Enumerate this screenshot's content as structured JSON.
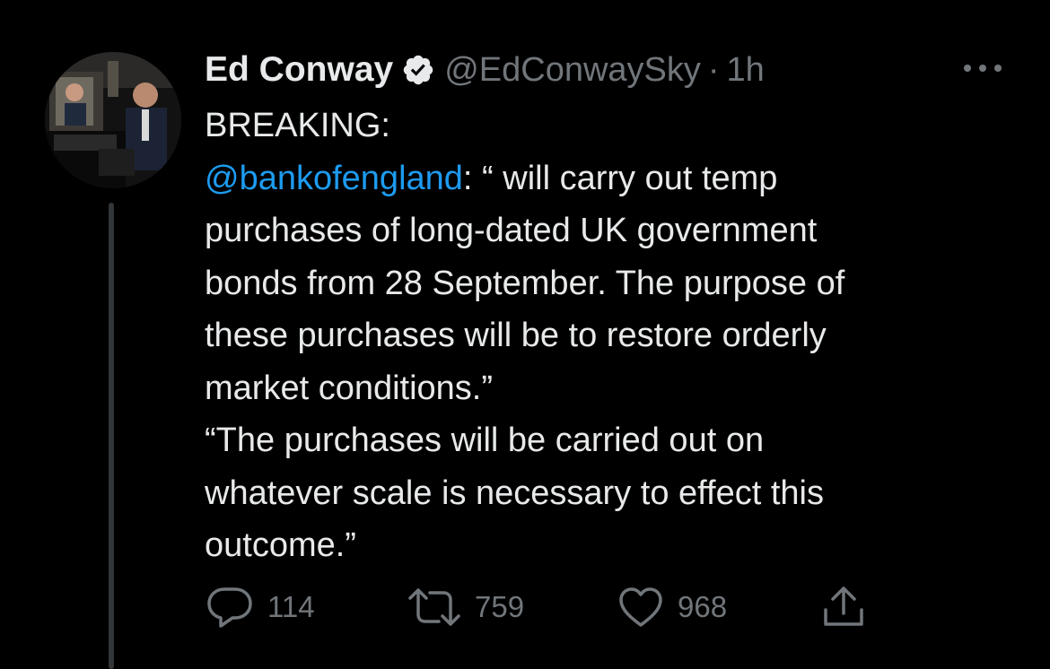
{
  "author": {
    "name": "Ed Conway",
    "handle": "@EdConwaySky",
    "separator": "·",
    "time": "1h",
    "verified": true
  },
  "tweet": {
    "line1": "BREAKING:",
    "mention": "@bankofengland",
    "line2_rest": ": “ will carry out temp",
    "line3": "purchases of long-dated UK government",
    "line4": "bonds from 28 September. The purpose of",
    "line5": "these purchases will be to restore orderly",
    "line6": "market conditions.”",
    "line7": "“The purchases will be carried out on",
    "line8": "whatever scale is necessary to effect this",
    "line9": "outcome.”"
  },
  "actions": {
    "replies": "114",
    "retweets": "759",
    "likes": "968"
  },
  "colors": {
    "background": "#000000",
    "text": "#e7e9ea",
    "secondary": "#71767b",
    "link": "#1d9bf0"
  }
}
